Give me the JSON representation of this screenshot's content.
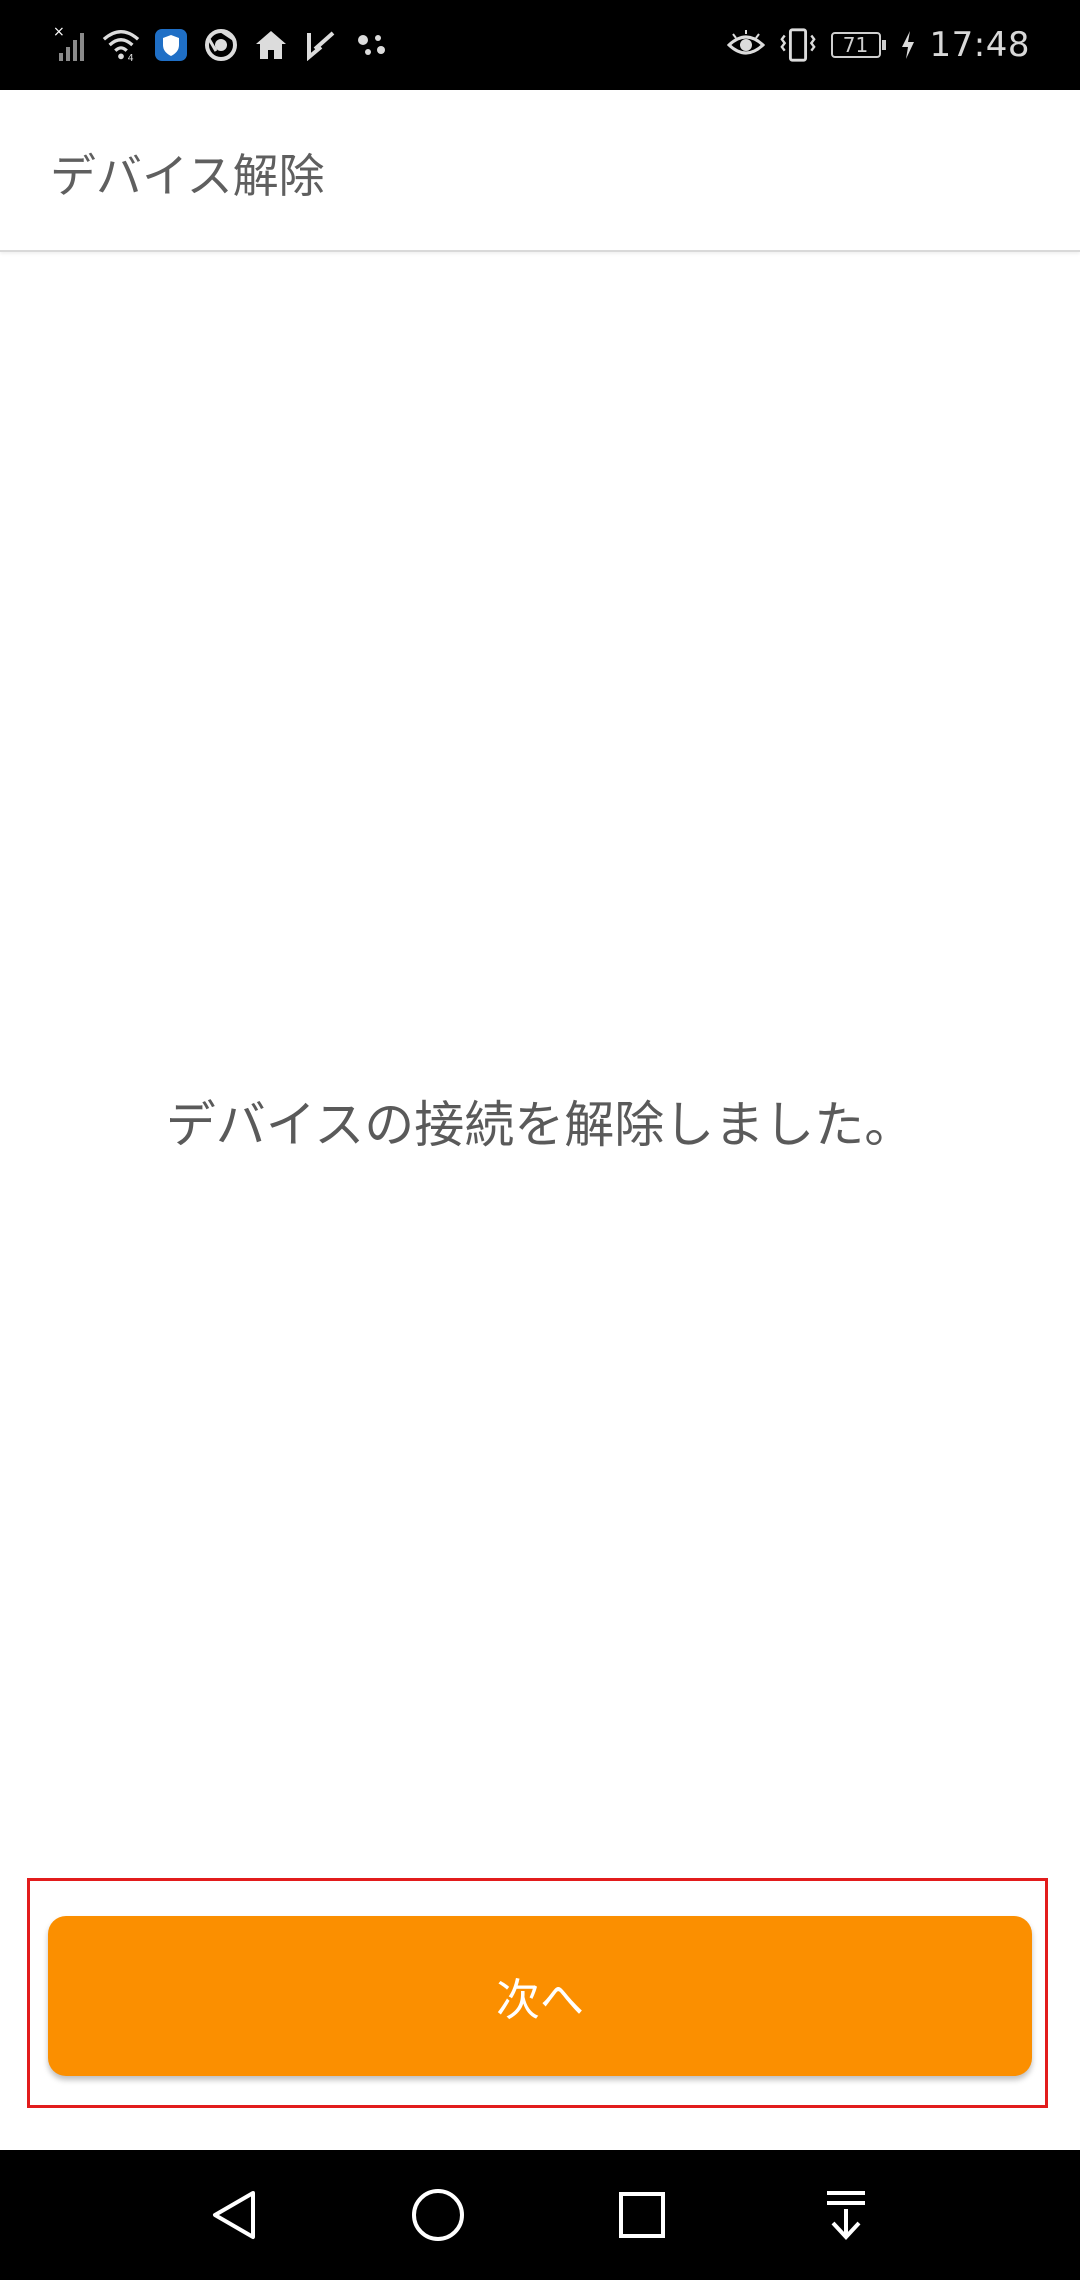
{
  "status_bar": {
    "time": "17:48",
    "battery_level": "71",
    "icons_left": [
      "signal-off-icon",
      "wifi-icon",
      "vpn-shield-icon",
      "chrome-icon",
      "home-icon",
      "play-check-icon",
      "assistant-dots-icon"
    ],
    "icons_right": [
      "eye-comfort-icon",
      "vibrate-icon",
      "battery-icon",
      "charging-icon"
    ]
  },
  "app_bar": {
    "title": "デバイス解除"
  },
  "main": {
    "message": "デバイスの接続を解除しました。"
  },
  "actions": {
    "next_label": "次へ",
    "button_color": "#fb8f00",
    "highlight_color": "#e21c1c"
  },
  "nav_bar": {
    "buttons": [
      "back-icon",
      "home-icon",
      "recents-icon",
      "notification-pull-icon"
    ]
  }
}
